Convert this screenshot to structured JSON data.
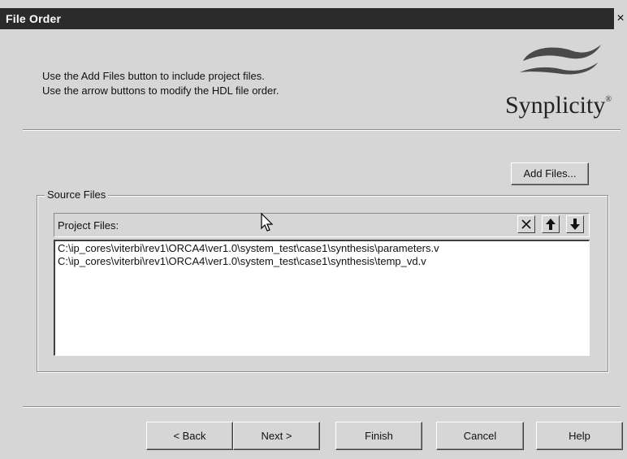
{
  "window": {
    "title": "File Order",
    "close_glyph": "×"
  },
  "instructions": {
    "line1": "Use the Add Files button to include project files.",
    "line2": "Use the arrow buttons to modify the HDL file order."
  },
  "logo": {
    "text": "Synplicity",
    "trademark": "®"
  },
  "buttons": {
    "add_files": "Add Files...",
    "back": "< Back",
    "next": "Next >",
    "finish": "Finish",
    "cancel": "Cancel",
    "help": "Help"
  },
  "source_files": {
    "group_label": "Source Files",
    "header_label": "Project Files:",
    "tool_icons": [
      "remove-icon",
      "move-up-icon",
      "move-down-icon"
    ],
    "files": [
      "C:\\ip_cores\\viterbi\\rev1\\ORCA4\\ver1.0\\system_test\\case1\\synthesis\\parameters.v",
      "C:\\ip_cores\\viterbi\\rev1\\ORCA4\\ver1.0\\system_test\\case1\\synthesis\\temp_vd.v"
    ]
  }
}
